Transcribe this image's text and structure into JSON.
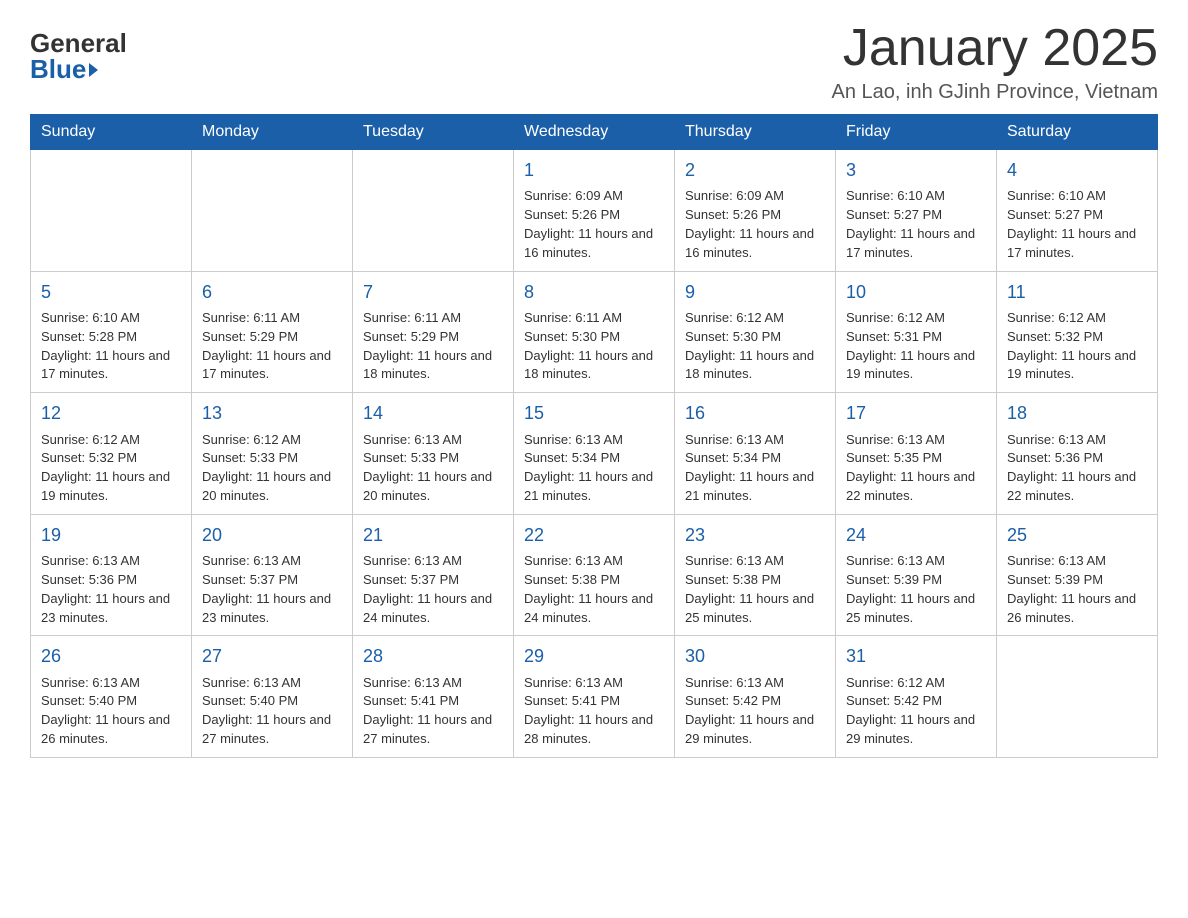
{
  "logo": {
    "top": "General",
    "bottom": "Blue"
  },
  "title": "January 2025",
  "subtitle": "An Lao, inh GJinh Province, Vietnam",
  "days_of_week": [
    "Sunday",
    "Monday",
    "Tuesday",
    "Wednesday",
    "Thursday",
    "Friday",
    "Saturday"
  ],
  "weeks": [
    [
      {
        "num": "",
        "info": ""
      },
      {
        "num": "",
        "info": ""
      },
      {
        "num": "",
        "info": ""
      },
      {
        "num": "1",
        "info": "Sunrise: 6:09 AM\nSunset: 5:26 PM\nDaylight: 11 hours and 16 minutes."
      },
      {
        "num": "2",
        "info": "Sunrise: 6:09 AM\nSunset: 5:26 PM\nDaylight: 11 hours and 16 minutes."
      },
      {
        "num": "3",
        "info": "Sunrise: 6:10 AM\nSunset: 5:27 PM\nDaylight: 11 hours and 17 minutes."
      },
      {
        "num": "4",
        "info": "Sunrise: 6:10 AM\nSunset: 5:27 PM\nDaylight: 11 hours and 17 minutes."
      }
    ],
    [
      {
        "num": "5",
        "info": "Sunrise: 6:10 AM\nSunset: 5:28 PM\nDaylight: 11 hours and 17 minutes."
      },
      {
        "num": "6",
        "info": "Sunrise: 6:11 AM\nSunset: 5:29 PM\nDaylight: 11 hours and 17 minutes."
      },
      {
        "num": "7",
        "info": "Sunrise: 6:11 AM\nSunset: 5:29 PM\nDaylight: 11 hours and 18 minutes."
      },
      {
        "num": "8",
        "info": "Sunrise: 6:11 AM\nSunset: 5:30 PM\nDaylight: 11 hours and 18 minutes."
      },
      {
        "num": "9",
        "info": "Sunrise: 6:12 AM\nSunset: 5:30 PM\nDaylight: 11 hours and 18 minutes."
      },
      {
        "num": "10",
        "info": "Sunrise: 6:12 AM\nSunset: 5:31 PM\nDaylight: 11 hours and 19 minutes."
      },
      {
        "num": "11",
        "info": "Sunrise: 6:12 AM\nSunset: 5:32 PM\nDaylight: 11 hours and 19 minutes."
      }
    ],
    [
      {
        "num": "12",
        "info": "Sunrise: 6:12 AM\nSunset: 5:32 PM\nDaylight: 11 hours and 19 minutes."
      },
      {
        "num": "13",
        "info": "Sunrise: 6:12 AM\nSunset: 5:33 PM\nDaylight: 11 hours and 20 minutes."
      },
      {
        "num": "14",
        "info": "Sunrise: 6:13 AM\nSunset: 5:33 PM\nDaylight: 11 hours and 20 minutes."
      },
      {
        "num": "15",
        "info": "Sunrise: 6:13 AM\nSunset: 5:34 PM\nDaylight: 11 hours and 21 minutes."
      },
      {
        "num": "16",
        "info": "Sunrise: 6:13 AM\nSunset: 5:34 PM\nDaylight: 11 hours and 21 minutes."
      },
      {
        "num": "17",
        "info": "Sunrise: 6:13 AM\nSunset: 5:35 PM\nDaylight: 11 hours and 22 minutes."
      },
      {
        "num": "18",
        "info": "Sunrise: 6:13 AM\nSunset: 5:36 PM\nDaylight: 11 hours and 22 minutes."
      }
    ],
    [
      {
        "num": "19",
        "info": "Sunrise: 6:13 AM\nSunset: 5:36 PM\nDaylight: 11 hours and 23 minutes."
      },
      {
        "num": "20",
        "info": "Sunrise: 6:13 AM\nSunset: 5:37 PM\nDaylight: 11 hours and 23 minutes."
      },
      {
        "num": "21",
        "info": "Sunrise: 6:13 AM\nSunset: 5:37 PM\nDaylight: 11 hours and 24 minutes."
      },
      {
        "num": "22",
        "info": "Sunrise: 6:13 AM\nSunset: 5:38 PM\nDaylight: 11 hours and 24 minutes."
      },
      {
        "num": "23",
        "info": "Sunrise: 6:13 AM\nSunset: 5:38 PM\nDaylight: 11 hours and 25 minutes."
      },
      {
        "num": "24",
        "info": "Sunrise: 6:13 AM\nSunset: 5:39 PM\nDaylight: 11 hours and 25 minutes."
      },
      {
        "num": "25",
        "info": "Sunrise: 6:13 AM\nSunset: 5:39 PM\nDaylight: 11 hours and 26 minutes."
      }
    ],
    [
      {
        "num": "26",
        "info": "Sunrise: 6:13 AM\nSunset: 5:40 PM\nDaylight: 11 hours and 26 minutes."
      },
      {
        "num": "27",
        "info": "Sunrise: 6:13 AM\nSunset: 5:40 PM\nDaylight: 11 hours and 27 minutes."
      },
      {
        "num": "28",
        "info": "Sunrise: 6:13 AM\nSunset: 5:41 PM\nDaylight: 11 hours and 27 minutes."
      },
      {
        "num": "29",
        "info": "Sunrise: 6:13 AM\nSunset: 5:41 PM\nDaylight: 11 hours and 28 minutes."
      },
      {
        "num": "30",
        "info": "Sunrise: 6:13 AM\nSunset: 5:42 PM\nDaylight: 11 hours and 29 minutes."
      },
      {
        "num": "31",
        "info": "Sunrise: 6:12 AM\nSunset: 5:42 PM\nDaylight: 11 hours and 29 minutes."
      },
      {
        "num": "",
        "info": ""
      }
    ]
  ]
}
